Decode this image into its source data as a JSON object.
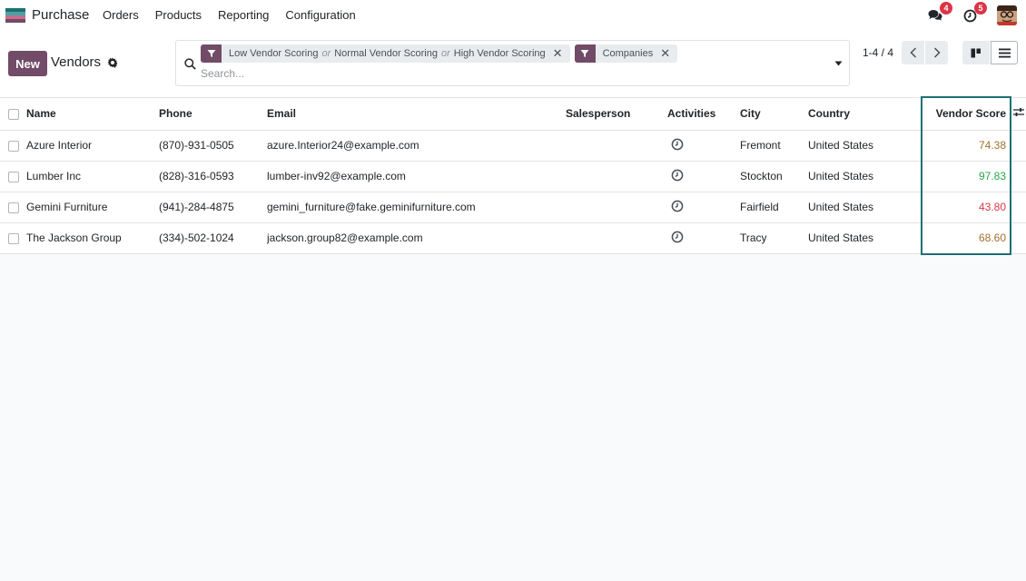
{
  "navbar": {
    "app_name": "Purchase",
    "menu": [
      "Orders",
      "Products",
      "Reporting",
      "Configuration"
    ],
    "messages_count": "4",
    "activities_count": "5",
    "brand_colors": [
      "#1e6f72",
      "#f0ad4e",
      "#714b67"
    ]
  },
  "control_panel": {
    "new_label": "New",
    "breadcrumb": "Vendors",
    "search_placeholder": "Search...",
    "facets": [
      {
        "icon": "filter-icon",
        "parts": [
          "Low Vendor Scoring",
          "Normal Vendor Scoring",
          "High Vendor Scoring"
        ],
        "separator": "or"
      },
      {
        "icon": "filter-icon",
        "parts": [
          "Companies"
        ],
        "separator": "or"
      }
    ],
    "pager": "1-4 / 4"
  },
  "table": {
    "columns": [
      "Name",
      "Phone",
      "Email",
      "Salesperson",
      "Activities",
      "City",
      "Country",
      "Vendor Score"
    ],
    "rows": [
      {
        "name": "Azure Interior",
        "phone": "(870)-931-0505",
        "email": "azure.Interior24@example.com",
        "salesperson": "",
        "city": "Fremont",
        "country": "United States",
        "score": "74.38",
        "score_color": "#a0732c"
      },
      {
        "name": "Lumber Inc",
        "phone": "(828)-316-0593",
        "email": "lumber-inv92@example.com",
        "salesperson": "",
        "city": "Stockton",
        "country": "United States",
        "score": "97.83",
        "score_color": "#28a745"
      },
      {
        "name": "Gemini Furniture",
        "phone": "(941)-284-4875",
        "email": "gemini_furniture@fake.geminifurniture.com",
        "salesperson": "",
        "city": "Fairfield",
        "country": "United States",
        "score": "43.80",
        "score_color": "#dc3545"
      },
      {
        "name": "The Jackson Group",
        "phone": "(334)-502-1024",
        "email": "jackson.group82@example.com",
        "salesperson": "",
        "city": "Tracy",
        "country": "United States",
        "score": "68.60",
        "score_color": "#a0732c"
      }
    ]
  }
}
